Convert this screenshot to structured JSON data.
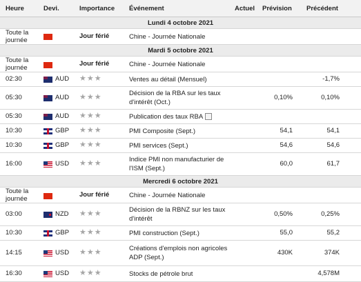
{
  "header": {
    "time": "Heure",
    "currency": "Devi.",
    "importance": "Importance",
    "event": "Événement",
    "actual": "Actuel",
    "forecast": "Prévision",
    "previous": "Précédent"
  },
  "days": [
    "Lundi 4 octobre 2021",
    "Mardi 5 octobre 2021",
    "Mercredi 6 octobre 2021"
  ],
  "rows": [
    {
      "time": "Toute la journée",
      "flag": "china-flag-icon",
      "currency": "",
      "importance": "Jour férié",
      "event": "Chine - Journée Nationale",
      "actual": "",
      "forecast": "",
      "previous": ""
    },
    {
      "time": "Toute la journée",
      "flag": "china-flag-icon",
      "currency": "",
      "importance": "Jour férié",
      "event": "Chine - Journée Nationale",
      "actual": "",
      "forecast": "",
      "previous": ""
    },
    {
      "time": "02:30",
      "flag": "australia-flag-icon",
      "currency": "AUD",
      "importance": "★★★",
      "event": "Ventes au détail (Mensuel)",
      "actual": "",
      "forecast": "",
      "previous": "-1,7%"
    },
    {
      "time": "05:30",
      "flag": "australia-flag-icon",
      "currency": "AUD",
      "importance": "★★★",
      "event": "Décision de la RBA sur les taux d'intérêt (Oct.)",
      "actual": "",
      "forecast": "0,10%",
      "previous": "0,10%"
    },
    {
      "time": "05:30",
      "flag": "australia-flag-icon",
      "currency": "AUD",
      "importance": "★★★",
      "event": "Publication des taux RBA",
      "actual": "",
      "forecast": "",
      "previous": ""
    },
    {
      "time": "10:30",
      "flag": "uk-flag-icon",
      "currency": "GBP",
      "importance": "★★★",
      "event": "PMI Composite (Sept.)",
      "actual": "",
      "forecast": "54,1",
      "previous": "54,1"
    },
    {
      "time": "10:30",
      "flag": "uk-flag-icon",
      "currency": "GBP",
      "importance": "★★★",
      "event": "PMI services (Sept.)",
      "actual": "",
      "forecast": "54,6",
      "previous": "54,6"
    },
    {
      "time": "16:00",
      "flag": "us-flag-icon",
      "currency": "USD",
      "importance": "★★★",
      "event": "Indice PMI non manufacturier de l'ISM (Sept.)",
      "actual": "",
      "forecast": "60,0",
      "previous": "61,7"
    },
    {
      "time": "Toute la journée",
      "flag": "china-flag-icon",
      "currency": "",
      "importance": "Jour férié",
      "event": "Chine - Journée Nationale",
      "actual": "",
      "forecast": "",
      "previous": ""
    },
    {
      "time": "03:00",
      "flag": "new-zealand-flag-icon",
      "currency": "NZD",
      "importance": "★★★",
      "event": "Décision de la RBNZ sur les taux d'intérêt",
      "actual": "",
      "forecast": "0,50%",
      "previous": "0,25%"
    },
    {
      "time": "10:30",
      "flag": "uk-flag-icon",
      "currency": "GBP",
      "importance": "★★★",
      "event": "PMI construction (Sept.)",
      "actual": "",
      "forecast": "55,0",
      "previous": "55,2"
    },
    {
      "time": "14:15",
      "flag": "us-flag-icon",
      "currency": "USD",
      "importance": "★★★",
      "event": "Créations d'emplois non agricoles ADP (Sept.)",
      "actual": "",
      "forecast": "430K",
      "previous": "374K"
    },
    {
      "time": "16:30",
      "flag": "us-flag-icon",
      "currency": "USD",
      "importance": "★★★",
      "event": "Stocks de pétrole brut",
      "actual": "",
      "forecast": "",
      "previous": "4,578M"
    }
  ]
}
